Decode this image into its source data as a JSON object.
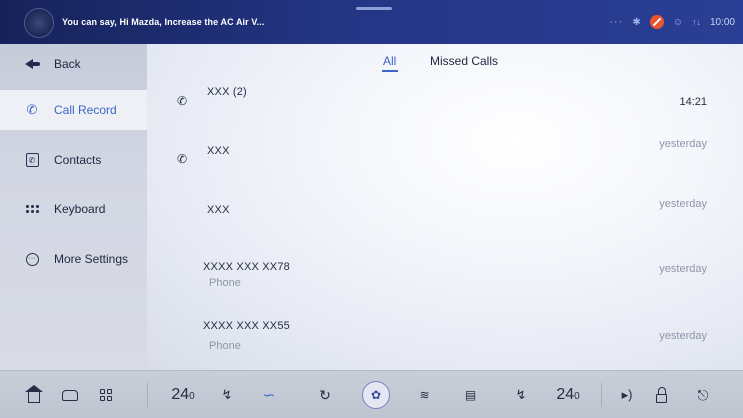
{
  "topbar": {
    "voice_hint": "You can say, Hi Mazda, Increase the AC Air V...",
    "status": {
      "dots": "···",
      "bluetooth": "✱",
      "person": "☺",
      "signal": "↑↓",
      "time": "10:00"
    }
  },
  "sidebar": {
    "back_label": "Back",
    "items": [
      {
        "label": "Call Record",
        "icon": "call-record-icon",
        "active": true
      },
      {
        "label": "Contacts",
        "icon": "contacts-icon",
        "active": false
      },
      {
        "label": "Keyboard",
        "icon": "keyboard-icon",
        "active": false
      },
      {
        "label": "More Settings",
        "icon": "more-settings-icon",
        "active": false
      }
    ]
  },
  "tabs": {
    "all": "All",
    "missed": "Missed Calls",
    "active": "All"
  },
  "calls": [
    {
      "name": "XXX (2)",
      "sub": "",
      "time": "14:21",
      "has_icon": true
    },
    {
      "name": "XXX",
      "sub": "",
      "time": "yesterday",
      "has_icon": true
    },
    {
      "name": "XXX",
      "sub": "",
      "time": "yesterday",
      "has_icon": false
    },
    {
      "name": "XXXX XXX  XX78",
      "sub": "Phone",
      "time": "yesterday",
      "has_icon": false
    },
    {
      "name": "XXXX XXX  XX55",
      "sub": "Phone",
      "time": "yesterday",
      "has_icon": false
    }
  ],
  "climate": {
    "left_temp": "24",
    "left_temp_decimal": "0",
    "right_temp": "24",
    "right_temp_decimal": "0"
  },
  "colors": {
    "accent": "#3c66c7",
    "topbar": "#233584",
    "mute_alert": "#e8542c"
  }
}
